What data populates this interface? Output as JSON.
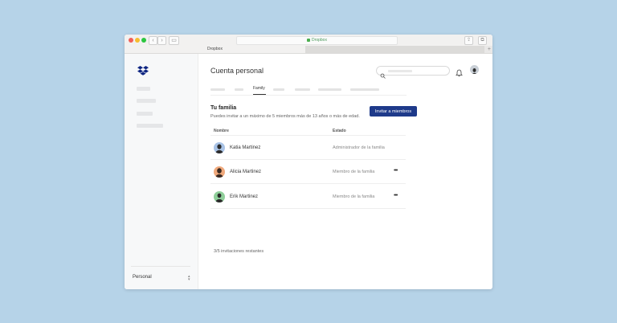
{
  "browser": {
    "url": "Dropbox",
    "tab_title": "Dropbox",
    "new_tab": "+"
  },
  "sidebar": {
    "logo_icon": "dropbox-logo-icon",
    "account_label": "Personal"
  },
  "header": {
    "title": "Cuenta personal",
    "search_icon": "search-icon",
    "bell_icon": "bell-icon"
  },
  "tabs": {
    "active_label": "Family"
  },
  "family": {
    "title": "Tu familia",
    "description": "Puedes invitar a un máximo de 5 miembros más de 13 años o más de edad.",
    "invite_button": "Invitar a miembros",
    "columns": [
      "Nombre",
      "Estado"
    ],
    "members": [
      {
        "name": "Katia Martinez",
        "status": "Administrador de la familia",
        "has_menu": false,
        "avatar_color": "#a9c3e6"
      },
      {
        "name": "Alicia Martinez",
        "status": "Miembro de la familia",
        "has_menu": true,
        "menu": "•••",
        "avatar_color": "#f0a97c"
      },
      {
        "name": "Erik Martinez",
        "status": "Miembro de la familia",
        "has_menu": true,
        "menu": "•••",
        "avatar_color": "#8fcf9a"
      }
    ],
    "remaining": "3/5 invitaciones restantes"
  },
  "colors": {
    "accent": "#1e3a8a",
    "background": "#b6d3e8"
  }
}
